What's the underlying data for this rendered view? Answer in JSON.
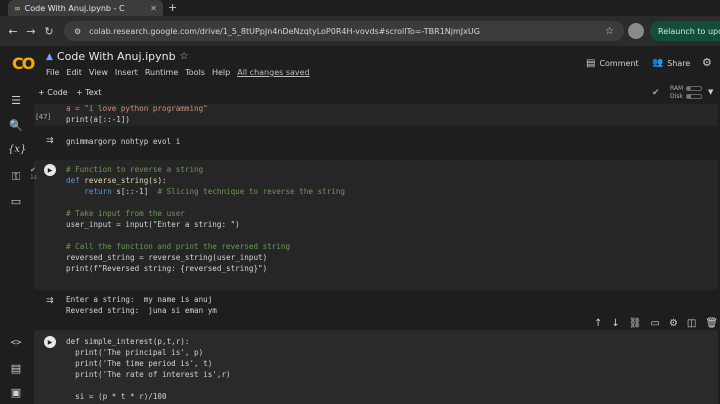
{
  "browser": {
    "tab_title": "Code With Anuj.ipynb - C",
    "new_tab": "+",
    "url": "colab.research.google.com/drive/1_5_8tUPpJn4nDeNzqtyLoP0R4H-vovds#scrollTo=-TBR1NjmJxUG",
    "relaunch_label": "Relaunch to upd"
  },
  "app": {
    "logo_text": "CO",
    "notebook_title": "Code With Anuj.ipynb",
    "menu": [
      "File",
      "Edit",
      "View",
      "Insert",
      "Runtime",
      "Tools",
      "Help"
    ],
    "saved_status": "All changes saved",
    "comment_label": "Comment",
    "share_label": "Share",
    "add_code_label": "+ Code",
    "add_text_label": "+ Text",
    "ram_label": "RAM",
    "disk_label": "Disk"
  },
  "cells": {
    "c1_exec": "[47]",
    "c1_line1": "a = \"i love python programming\"",
    "c1_line2": "print(a[::-1])",
    "c1_output": "gnimmargorp nohtyp evol i",
    "c2_time": "1s",
    "c2_comment1": "# Function to reverse a string",
    "c2_def": "def",
    "c2_defname": "reverse_string(s):",
    "c2_return_kw": "return",
    "c2_return_expr": " s[::-1]  ",
    "c2_return_comment": "# Slicing technique to reverse the string",
    "c2_comment2": "# Take input from the user",
    "c2_input_line": "user_input = input(\"Enter a string: \")",
    "c2_comment3": "# Call the function and print the reversed string",
    "c2_call_line": "reversed_string = reverse_string(user_input)",
    "c2_print_line": "print(f\"Reversed string: {reversed_string}\")",
    "c2_output1": "Enter a string:  my name is anuj",
    "c2_output2": "Reversed string:  juna si eman ym",
    "c3_line1": "def simple_interest(p,t,r):",
    "c3_line2": "  print('The principal is', p)",
    "c3_line3": "  print('The time period is', t)",
    "c3_line4": "  print('The rate of interest is',r)",
    "c3_line5": "  si = (p * t * r)/100"
  }
}
